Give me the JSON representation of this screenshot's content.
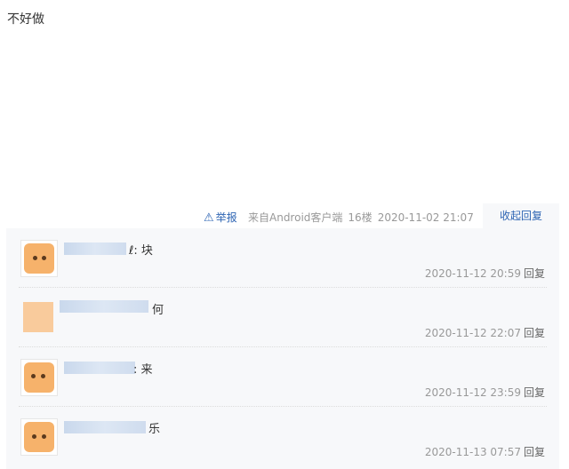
{
  "post": {
    "content": "不好做"
  },
  "tail": {
    "report_label": "举报",
    "source": "来自Android客户端",
    "floor": "16楼",
    "time": "2020-11-02 21:07",
    "fold_label": "收起回复"
  },
  "replies": [
    {
      "text": "ℓ: 块",
      "time": "2020-11-12 20:59",
      "reply_label": "回复"
    },
    {
      "text": "何",
      "time": "2020-11-12 22:07",
      "reply_label": "回复"
    },
    {
      "text": ": 来",
      "time": "2020-11-12 23:59",
      "reply_label": "回复"
    },
    {
      "text": "乐",
      "time": "2020-11-13 07:57",
      "reply_label": "回复"
    }
  ],
  "colors": {
    "link": "#2d64b3",
    "meta": "#999999",
    "panel": "#f7f8fa"
  },
  "icons": {
    "report": "warning-triangle-icon"
  }
}
